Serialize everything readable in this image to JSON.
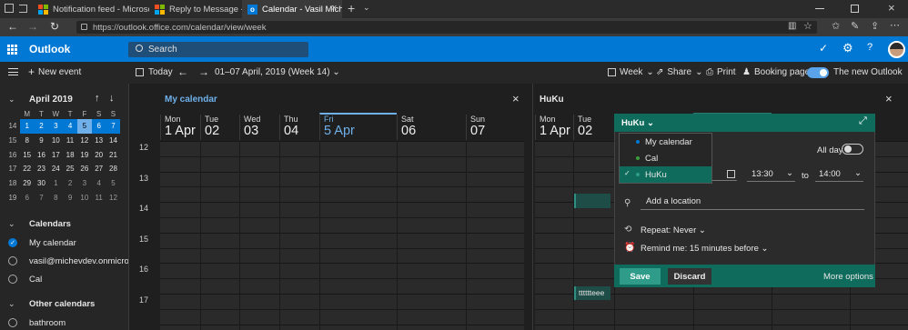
{
  "browser": {
    "tabs": [
      {
        "title": "Notification feed - Microsof"
      },
      {
        "title": "Reply to Message - Microso"
      },
      {
        "title": "Calendar - Vasil Michev"
      }
    ],
    "url": "https://outlook.office.com/calendar/view/week"
  },
  "app": {
    "name": "Outlook",
    "search_placeholder": "Search"
  },
  "toolbar": {
    "new_event": "New event",
    "today": "Today",
    "date_range": "01–07 April, 2019 (Week 14)",
    "view": "Week",
    "share": "Share",
    "print": "Print",
    "booking_page": "Booking page",
    "new_outlook": "The new Outlook"
  },
  "mini_calendar": {
    "title": "April 2019",
    "weekday_headers": [
      "M",
      "T",
      "W",
      "T",
      "F",
      "S",
      "S"
    ],
    "weeks": [
      {
        "wk": "14",
        "days": [
          "1",
          "2",
          "3",
          "4",
          "5",
          "6",
          "7"
        ]
      },
      {
        "wk": "15",
        "days": [
          "8",
          "9",
          "10",
          "11",
          "12",
          "13",
          "14"
        ]
      },
      {
        "wk": "16",
        "days": [
          "15",
          "16",
          "17",
          "18",
          "19",
          "20",
          "21"
        ]
      },
      {
        "wk": "17",
        "days": [
          "22",
          "23",
          "24",
          "25",
          "26",
          "27",
          "28"
        ]
      },
      {
        "wk": "18",
        "days": [
          "29",
          "30",
          "1",
          "2",
          "3",
          "4",
          "5"
        ]
      },
      {
        "wk": "19",
        "days": [
          "6",
          "7",
          "8",
          "9",
          "10",
          "11",
          "12"
        ]
      }
    ]
  },
  "sidebar": {
    "calendars_header": "Calendars",
    "calendars": [
      {
        "label": "My calendar",
        "checked": true
      },
      {
        "label": "vasil@michevdev.onmicro...",
        "checked": false
      },
      {
        "label": "Cal",
        "checked": false
      }
    ],
    "other_header": "Other calendars",
    "other": [
      {
        "label": "bathroom"
      }
    ]
  },
  "my_calendar": {
    "title": "My calendar",
    "days": [
      {
        "dow": "Mon",
        "num": "1 Apr"
      },
      {
        "dow": "Tue",
        "num": "02"
      },
      {
        "dow": "Wed",
        "num": "03"
      },
      {
        "dow": "Thu",
        "num": "04"
      },
      {
        "dow": "Fri",
        "num": "5 Apr"
      },
      {
        "dow": "Sat",
        "num": "06"
      },
      {
        "dow": "Sun",
        "num": "07"
      }
    ],
    "hours": [
      "12",
      "13",
      "14",
      "15",
      "16",
      "17"
    ]
  },
  "huku_calendar": {
    "title": "HuKu",
    "days": [
      {
        "dow": "Mon",
        "num": "1 Apr"
      },
      {
        "dow": "Tue",
        "num": "02"
      }
    ],
    "event": "tttttteee"
  },
  "popup": {
    "calendar_selector": "HuKu",
    "options": [
      "My calendar",
      "Cal",
      "HuKu"
    ],
    "all_day": "All day",
    "start_time": "13:30",
    "to": "to",
    "end_time": "14:00",
    "location_placeholder": "Add a location",
    "repeat": "Repeat: Never",
    "remind": "Remind me: 15 minutes before",
    "save": "Save",
    "discard": "Discard",
    "more_options": "More options"
  },
  "colors": {
    "accent": "#0078d4",
    "teal": "#0f6c5c",
    "today": "#6fb0ea"
  }
}
